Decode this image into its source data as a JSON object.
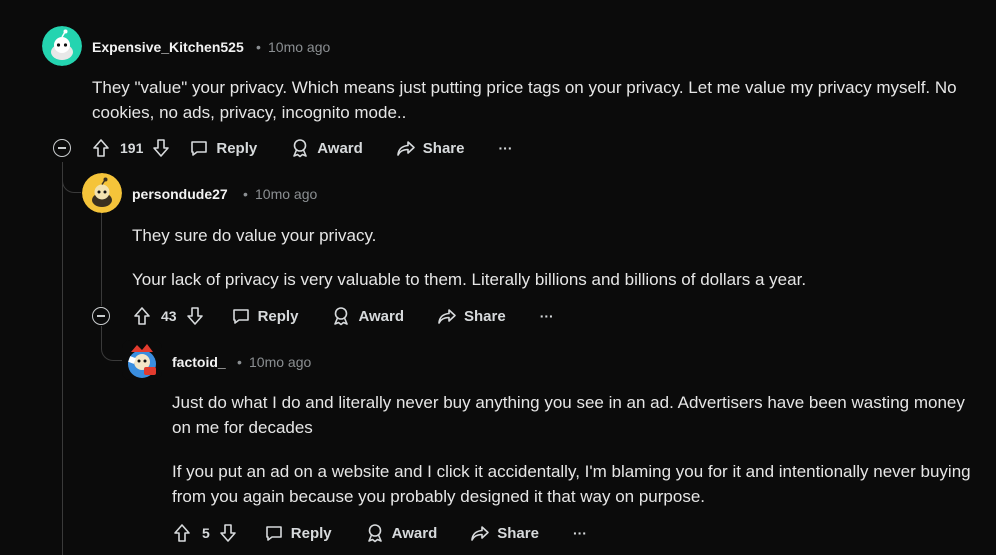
{
  "comments": [
    {
      "username": "Expensive_Kitchen525",
      "time": "10mo ago",
      "avatar_color": "#24d4b0",
      "paragraphs": [
        "They \"value\" your privacy. Which means just putting price tags on your privacy. Let me value my privacy myself. No cookies, no ads, privacy, incognito mode.."
      ],
      "votes": "191",
      "reply_label": "Reply",
      "award_label": "Award",
      "share_label": "Share",
      "more_label": "···"
    },
    {
      "username": "persondude27",
      "time": "10mo ago",
      "avatar_color": "#f5c43a",
      "paragraphs": [
        "They sure do value your privacy.",
        "Your lack of privacy is very valuable to them. Literally billions and billions of dollars a year."
      ],
      "votes": "43",
      "reply_label": "Reply",
      "award_label": "Award",
      "share_label": "Share",
      "more_label": "···"
    },
    {
      "username": "factoid_",
      "time": "10mo ago",
      "avatar_color": "#3a8ee0",
      "paragraphs": [
        "Just do what I do and literally never buy anything you see in an ad. Advertisers have been wasting money on me for decades",
        "If you put an ad on a website and I click it accidentally, I'm blaming you for it and intentionally never buying from you again because you probably designed it that way on purpose."
      ],
      "votes": "5",
      "reply_label": "Reply",
      "award_label": "Award",
      "share_label": "Share",
      "more_label": "···"
    }
  ],
  "separator": "•"
}
